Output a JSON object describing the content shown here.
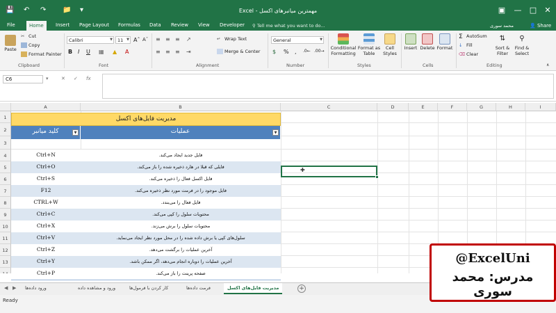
{
  "window": {
    "title": "Excel - مهمترین میانبرهای اکسل",
    "user": "محمد سوری",
    "share_label": "Share"
  },
  "tabs": [
    "File",
    "Home",
    "Insert",
    "Page Layout",
    "Formulas",
    "Data",
    "Review",
    "View",
    "Developer"
  ],
  "tell_me": "Tell me what you want to do...",
  "ribbon": {
    "clipboard": {
      "label": "Clipboard",
      "paste": "Paste",
      "cut": "Cut",
      "copy": "Copy",
      "format_painter": "Format Painter"
    },
    "font": {
      "label": "Font",
      "font_name": "Calibri",
      "font_size": "11"
    },
    "alignment": {
      "label": "Alignment",
      "wrap": "Wrap Text",
      "merge": "Merge & Center"
    },
    "number": {
      "label": "Number",
      "format": "General"
    },
    "styles": {
      "label": "Styles",
      "conditional": "Conditional Formatting",
      "format_table": "Format as Table",
      "cell_styles": "Cell Styles"
    },
    "cells": {
      "label": "Cells",
      "insert": "Insert",
      "delete": "Delete",
      "format": "Format"
    },
    "editing": {
      "label": "Editing",
      "autosum": "AutoSum",
      "fill": "Fill",
      "clear": "Clear",
      "sort": "Sort & Filter",
      "find": "Find & Select"
    }
  },
  "formula_bar": {
    "name_box": "C6",
    "fx": "fx",
    "formula": ""
  },
  "columns": [
    "A",
    "B",
    "C",
    "D",
    "E",
    "F",
    "G",
    "H",
    "I"
  ],
  "rows": [
    "1",
    "2",
    "3",
    "4",
    "5",
    "6",
    "7",
    "8",
    "9",
    "10",
    "11",
    "12",
    "13",
    "14"
  ],
  "table": {
    "title": "مدیریت فایل‌های اکسل",
    "headers": {
      "key": "کلید میانبر",
      "operation": "عملیات"
    },
    "rows": [
      {
        "key": "Ctrl+N",
        "op": "فایل جدید ایجاد می‌کند."
      },
      {
        "key": "Ctrl+O",
        "op": "فایلی که قبلا در هارد ذخیره شده را باز می‌کند."
      },
      {
        "key": "Ctrl+S",
        "op": "فایل اکسل فعال را ذخیره می‌کند."
      },
      {
        "key": "F12",
        "op": "فایل موجود را در فرمت مورد نظر ذخیره می‌کند."
      },
      {
        "key": "CTRL+W",
        "op": "فایل فعال را می‌بندد."
      },
      {
        "key": "Ctrl+C",
        "op": "محتویات سلول را کپی می‌کند."
      },
      {
        "key": "Ctrl+X",
        "op": "محتویات سلول را برش می‌زند."
      },
      {
        "key": "Ctrl+V",
        "op": "سلول‌های کپی یا برش داده شده را در محل مورد نظر ایجاد می‌نماید."
      },
      {
        "key": "Ctrl+Z",
        "op": "آخرین عملیات را برگشت می‌دهد."
      },
      {
        "key": "Ctrl+Y",
        "op": "آخرین عملیات را دوباره انجام می‌دهد، اگر ممکن باشد."
      },
      {
        "key": "Ctrl+P",
        "op": "صفحه پرینت را باز می‌کند."
      }
    ]
  },
  "sheet_tabs": [
    "مدیریت فایل‌های اکسل",
    "فرمت داده‌ها",
    "کار کردن با فرمول‌ها",
    "ورود و مشاهده داده",
    "ورود داده‌ها"
  ],
  "active_sheet_index": 0,
  "status": {
    "ready": "Ready"
  },
  "overlay": {
    "handle": "@ExcelUni",
    "teacher": "مدرس: محمد سوری"
  },
  "colors": {
    "excel_green": "#217346",
    "title_fill": "#ffd966",
    "header_fill": "#4f81bd",
    "row_band": "#dce6f1",
    "badge_border": "#c00000"
  }
}
